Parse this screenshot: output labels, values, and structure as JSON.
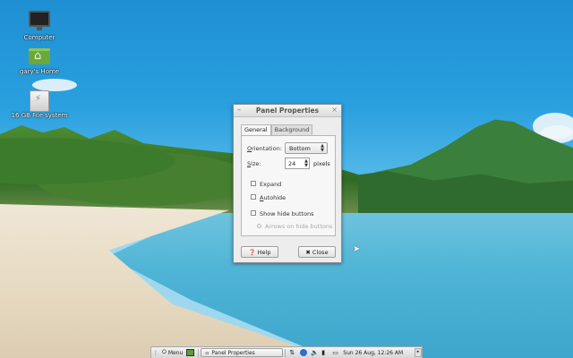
{
  "desktop": {
    "icons": [
      {
        "label": "Computer",
        "icon": "monitor-icon"
      },
      {
        "label": "gary's Home",
        "icon": "home-folder-icon"
      },
      {
        "label": "16 GB File system",
        "icon": "drive-icon"
      }
    ]
  },
  "dialog": {
    "title": "Panel Properties",
    "menu_glyph": "–",
    "close_glyph": "×",
    "tabs": [
      {
        "label": "General",
        "active": true
      },
      {
        "label": "Background",
        "active": false
      }
    ],
    "orientation_label": "Orientation:",
    "orientation_value": "Bottom",
    "size_label": "Size:",
    "size_value": "24",
    "size_unit": "pixels",
    "expand_label": "Expand",
    "autohide_label": "Autohide",
    "show_hide_label": "Show hide buttons",
    "arrows_label": "Arrows on hide buttons",
    "help_label": "Help",
    "close_label": "Close"
  },
  "taskbar": {
    "menu_label": "Menu",
    "task_label": "Panel Properties",
    "clock": "Sun 26 Aug, 12:26 AM"
  }
}
